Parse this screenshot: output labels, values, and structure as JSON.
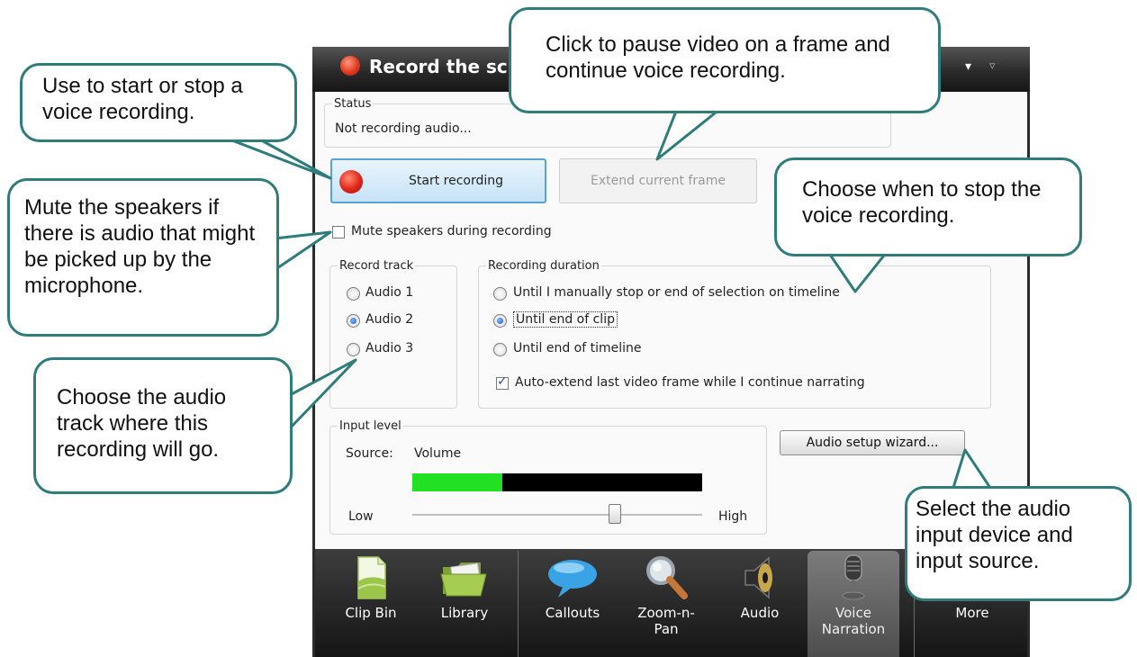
{
  "window": {
    "title": "Record the scre",
    "menu_arrow_glyph": "▾",
    "pin_glyph": "▿"
  },
  "status": {
    "legend": "Status",
    "text": "Not recording audio..."
  },
  "buttons": {
    "start": "Start recording",
    "extend": "Extend current frame",
    "wizard": "Audio setup wizard..."
  },
  "mute": {
    "label": "Mute speakers during recording",
    "checked": false
  },
  "record_track": {
    "legend": "Record track",
    "options": [
      "Audio 1",
      "Audio 2",
      "Audio 3"
    ],
    "selected": "Audio 2"
  },
  "recording_duration": {
    "legend": "Recording duration",
    "options": [
      "Until I manually stop or end of selection on timeline",
      "Until end of clip",
      "Until end of timeline"
    ],
    "selected": "Until end of clip",
    "auto_extend": {
      "label": "Auto-extend last video frame while I continue narrating",
      "checked": true
    }
  },
  "input_level": {
    "legend": "Input level",
    "source_label": "Source:",
    "source_value": "Volume",
    "meter_level": 0.31,
    "low_label": "Low",
    "high_label": "High",
    "slider_value": 0.7
  },
  "tabs": [
    {
      "label": "Clip Bin",
      "icon": "clip-bin-icon"
    },
    {
      "label": "Library",
      "icon": "library-folder-icon"
    },
    {
      "label": "Callouts",
      "icon": "speech-bubble-icon"
    },
    {
      "label": "Zoom-n-Pan",
      "icon": "magnifier-icon"
    },
    {
      "label": "Audio",
      "icon": "speaker-icon"
    },
    {
      "label": "Voice Narration",
      "icon": "microphone-icon",
      "active": true
    },
    {
      "label": "More",
      "icon": ""
    }
  ],
  "callouts": {
    "start_stop": "Use to start or stop a voice recording.",
    "pause": "Click to pause video on a frame and continue voice recording.",
    "mute": "Mute the speakers if there is audio that might be picked up by the microphone.",
    "stop_when": "Choose when to stop the voice recording.",
    "track": "Choose the audio track where this recording will go.",
    "select_device": "Select the audio input device and input source."
  },
  "colors": {
    "callout_border": "#2e7c7c",
    "record_red": "#e1241a",
    "meter_green": "#22e022",
    "button_blue_border": "#5aa3d0"
  }
}
